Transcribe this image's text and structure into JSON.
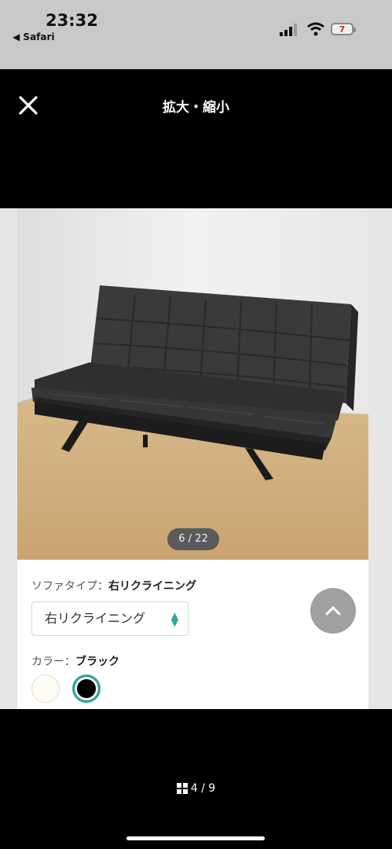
{
  "status_bar": {
    "time": "23:32",
    "back_app": "Safari",
    "battery": "7"
  },
  "sheet": {
    "title": "拡大・縮小"
  },
  "product": {
    "image_counter": "6 / 22",
    "sofa_type_label": "ソファタイプ：",
    "sofa_type_value": "右リクライニング",
    "select_value": "右リクライニング",
    "color_label": "カラー：",
    "color_value": "ブラック",
    "swatches": [
      "#fffdf3",
      "#000000"
    ],
    "accent_color": "#2aa89a"
  },
  "pager": {
    "text": "4 / 9"
  },
  "icons": [
    "back-triangle-icon",
    "signal-icon",
    "wifi-icon",
    "battery-icon",
    "close-icon",
    "select-arrows-icon",
    "chevron-up-icon",
    "grid-icon"
  ]
}
